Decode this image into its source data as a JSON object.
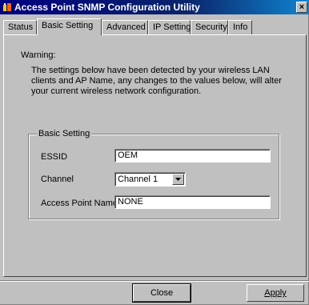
{
  "window": {
    "title": "Access Point SNMP Configuration Utility",
    "close_glyph": "×"
  },
  "tabs": [
    {
      "label": "Status",
      "active": false
    },
    {
      "label": "Basic Setting",
      "active": true
    },
    {
      "label": "Advanced",
      "active": false
    },
    {
      "label": "IP Setting",
      "active": false
    },
    {
      "label": "Security",
      "active": false
    },
    {
      "label": "Info",
      "active": false
    }
  ],
  "warning": {
    "label": "Warning:",
    "text": "The settings below have been detected by your wireless LAN clients and AP Name, any changes to the values below, will alter your current wireless network configuration."
  },
  "basic_setting": {
    "group_label": "Basic Setting",
    "essid": {
      "label": "ESSID",
      "value": "OEM"
    },
    "channel": {
      "label": "Channel",
      "value": "Channel 1"
    },
    "ap_name": {
      "label": "Access Point Name",
      "value": "NONE"
    }
  },
  "buttons": {
    "close": "Close",
    "apply": "Apply"
  },
  "colors": {
    "title_bar": "#000080",
    "face": "#c0c0c0"
  }
}
